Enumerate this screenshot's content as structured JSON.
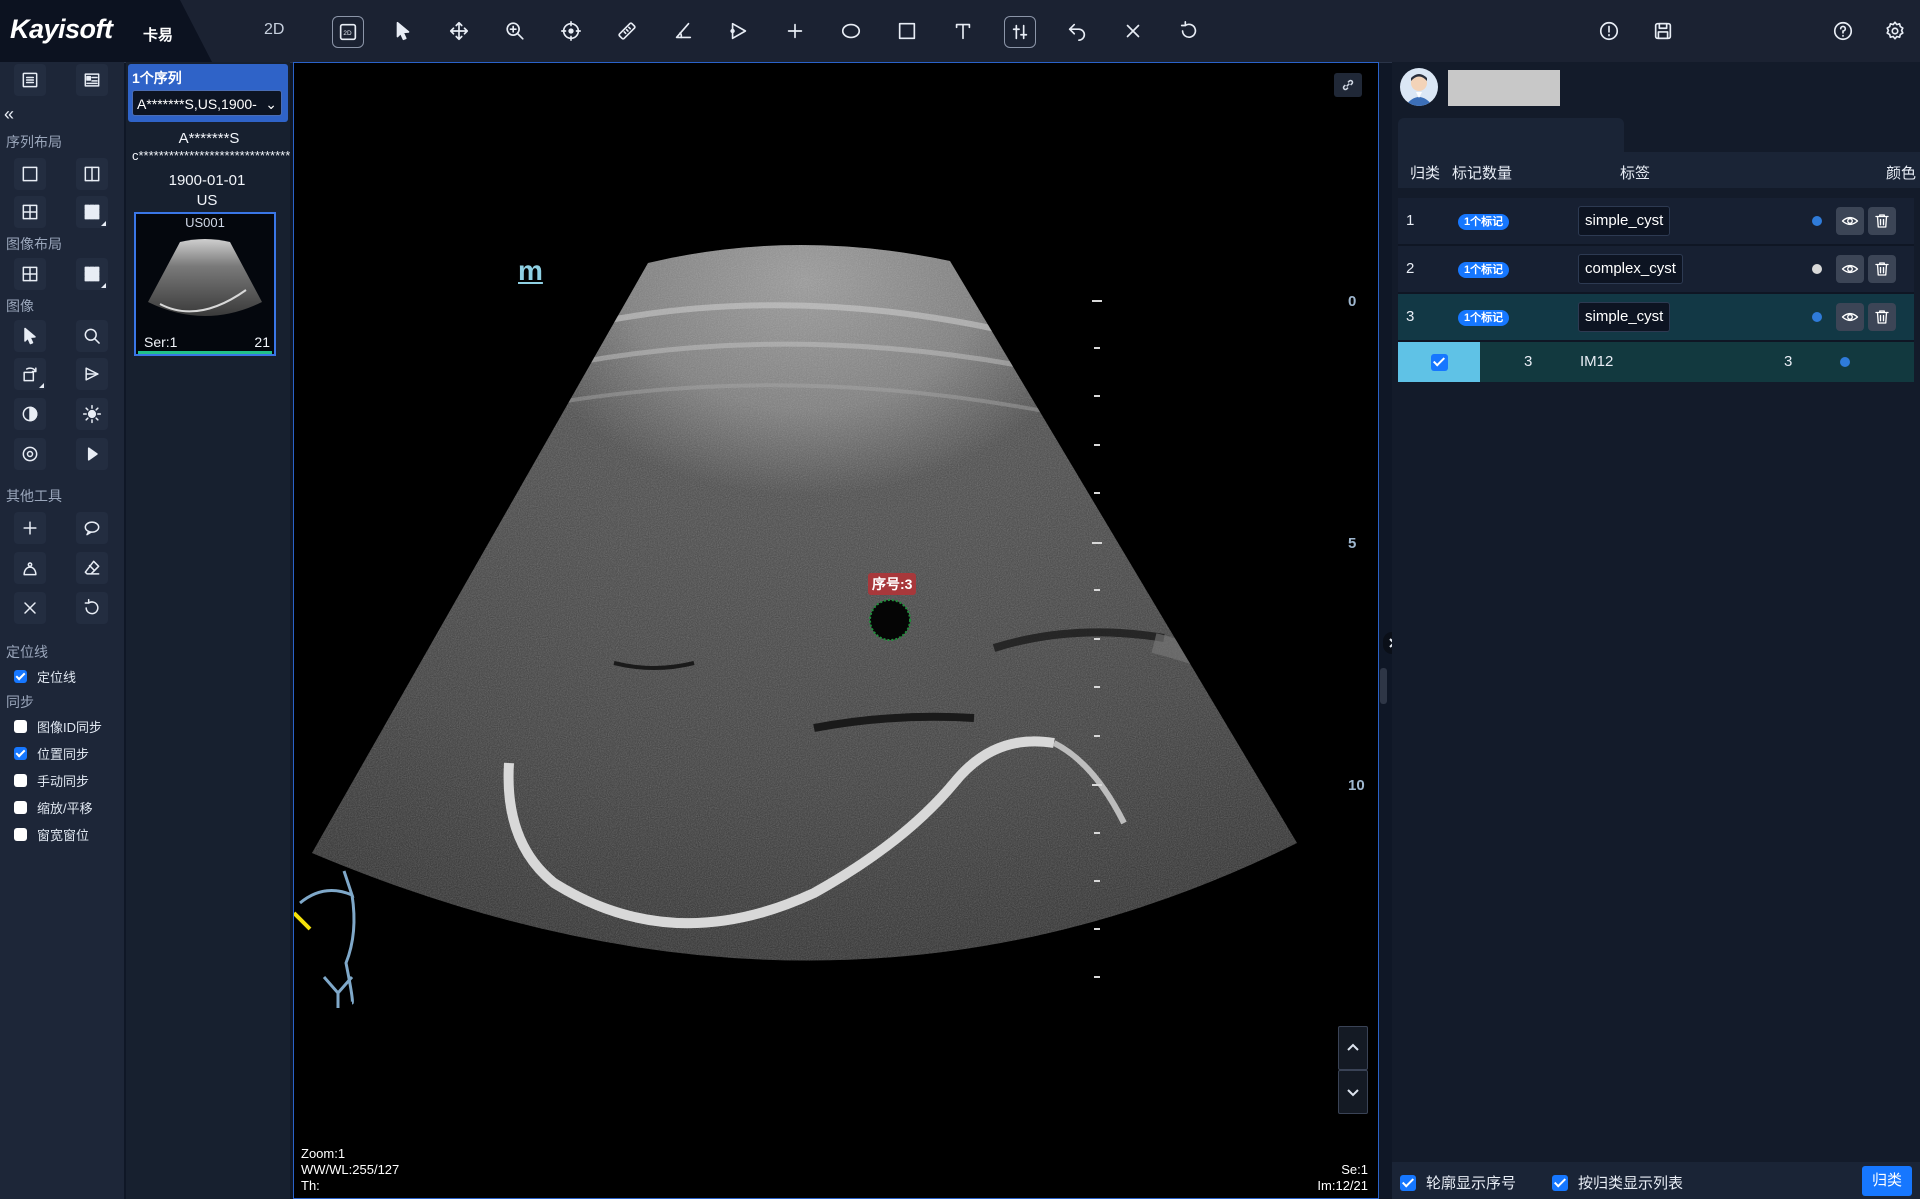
{
  "app": {
    "brand": "Kayisoft",
    "brand_cn": "卡易",
    "mode": "2D"
  },
  "toolbar": {
    "icons": [
      "layout-2d-icon",
      "pointer-icon",
      "pan-icon",
      "zoom-icon",
      "crosshair-icon",
      "ruler-icon",
      "angle-icon",
      "polygon-icon",
      "cross-icon",
      "ellipse-icon",
      "rectangle-icon",
      "text-icon",
      "adjust-icon",
      "undo-icon",
      "close-icon",
      "reset-icon",
      "info-icon",
      "save-icon",
      "help-icon",
      "settings-icon"
    ]
  },
  "left_panel": {
    "sections": {
      "series_layout": "序列布局",
      "image_layout": "图像布局",
      "image": "图像",
      "other_tools": "其他工具",
      "locator": "定位线",
      "sync": "同步"
    },
    "checkboxes": [
      {
        "label": "定位线",
        "checked": true
      },
      {
        "label": "图像ID同步",
        "checked": false
      },
      {
        "label": "位置同步",
        "checked": true
      },
      {
        "label": "手动同步",
        "checked": false
      },
      {
        "label": "缩放/平移",
        "checked": false
      },
      {
        "label": "窗宽窗位",
        "checked": false
      }
    ]
  },
  "series_panel": {
    "count_label": "1个序列",
    "selected": "A*******S,US,1900-",
    "patient_name": "A*******S",
    "patient_id": "c******************************",
    "study_date": "1900-01-01",
    "modality": "US",
    "thumb": {
      "name": "US001",
      "series": "Ser:1",
      "count": "21"
    }
  },
  "viewport": {
    "marker": "m",
    "annotation_label": "序号:3",
    "depth_scale": [
      "0",
      "5",
      "10"
    ],
    "depth_range_cm": [
      0,
      14
    ],
    "overlay": {
      "zoom": "Zoom:1",
      "wwwl": "WW/WL:255/127",
      "th": "Th:",
      "se": "Se:1",
      "im": "Im:12/21"
    }
  },
  "right_panel": {
    "headers": {
      "category": "归类",
      "count": "标记数量",
      "label": "标签",
      "color": "颜色"
    },
    "rows": [
      {
        "index": "1",
        "badge": "1个标记",
        "label": "simple_cyst",
        "color": "#2f7bd9"
      },
      {
        "index": "2",
        "badge": "1个标记",
        "label": "complex_cyst",
        "color": "#d9d9d9"
      },
      {
        "index": "3",
        "badge": "1个标记",
        "label": "simple_cyst",
        "color": "#2f7bd9"
      }
    ],
    "sub_row": {
      "col1": "3",
      "image": "IM12",
      "col3": "3",
      "color": "#2f7bd9"
    },
    "bottom": {
      "show_contour_index": "轮廓显示序号",
      "show_list_by_class": "按归类显示列表",
      "classify_button": "归类"
    }
  }
}
